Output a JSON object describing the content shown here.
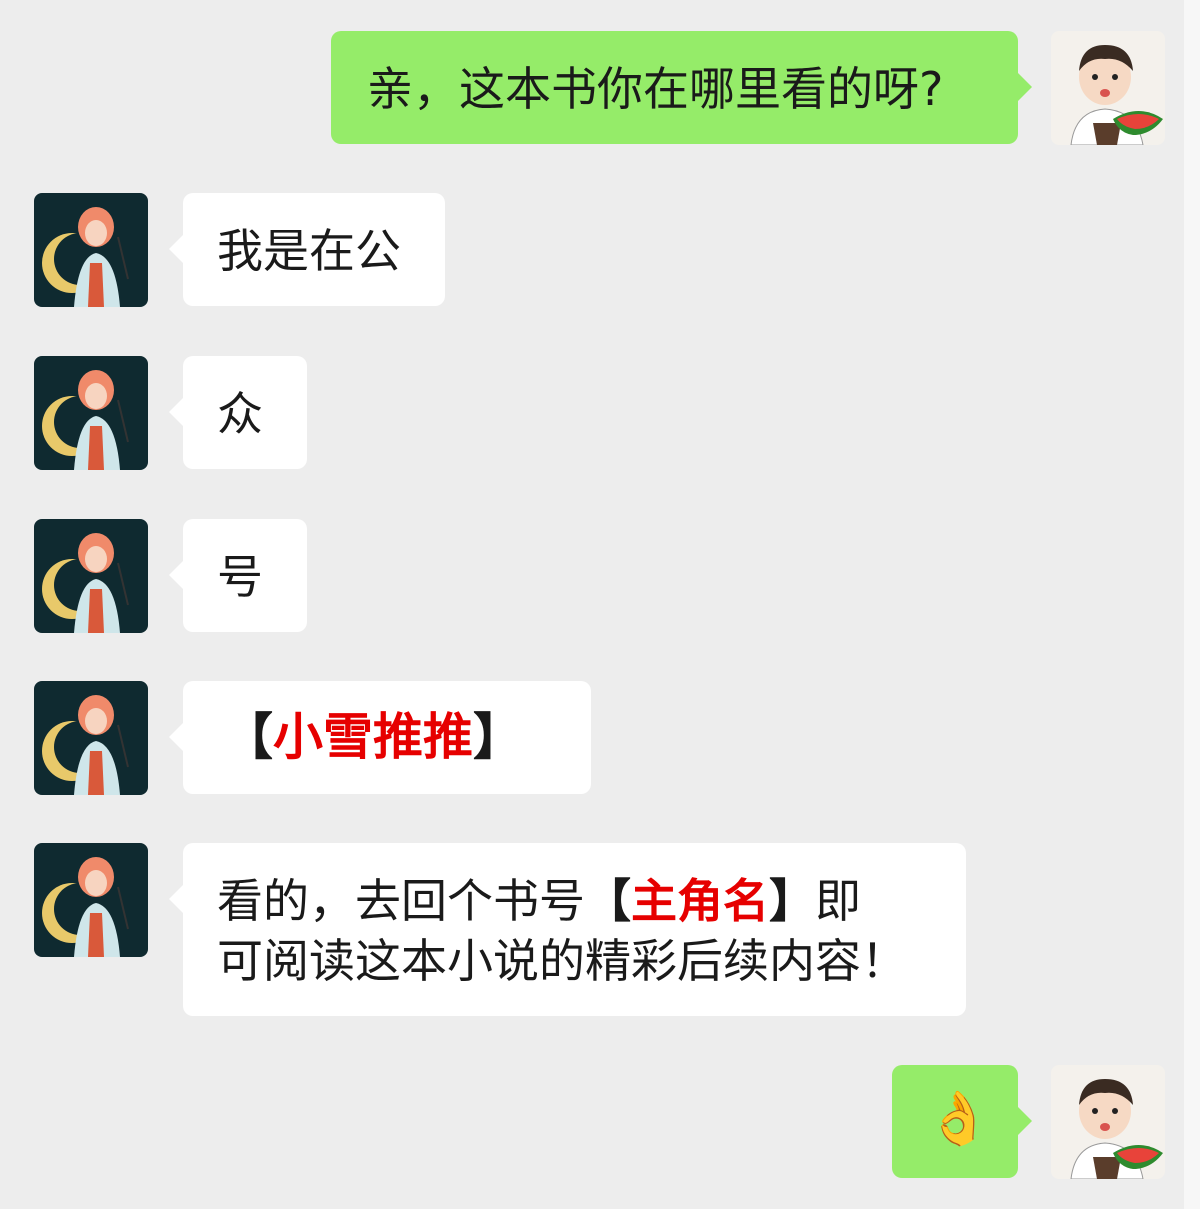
{
  "accent_colors": {
    "outgoing_bubble": "#95ec69",
    "incoming_bubble": "#ffffff",
    "background": "#ededed",
    "highlight_text": "#e60000"
  },
  "messages": [
    {
      "side": "outgoing",
      "avatar": "girl-watermelon-avatar",
      "text": "亲，这本书你在哪里看的呀?"
    },
    {
      "side": "incoming",
      "avatar": "anime-girl-avatar",
      "text": "我是在公"
    },
    {
      "side": "incoming",
      "avatar": "anime-girl-avatar",
      "text": "众"
    },
    {
      "side": "incoming",
      "avatar": "anime-girl-avatar",
      "text": "号"
    },
    {
      "side": "incoming",
      "avatar": "anime-girl-avatar",
      "bracket_open": "【",
      "highlight": "小雪推推",
      "bracket_close": "】"
    },
    {
      "side": "incoming",
      "avatar": "anime-girl-avatar",
      "line1_prefix": "看的，去回个书号",
      "bracket_open": "【",
      "highlight": "主角名",
      "bracket_close": "】",
      "line1_suffix": "即",
      "line2": "可阅读这本小说的精彩后续内容！"
    },
    {
      "side": "outgoing",
      "avatar": "girl-watermelon-avatar",
      "emoji": "👌"
    }
  ]
}
